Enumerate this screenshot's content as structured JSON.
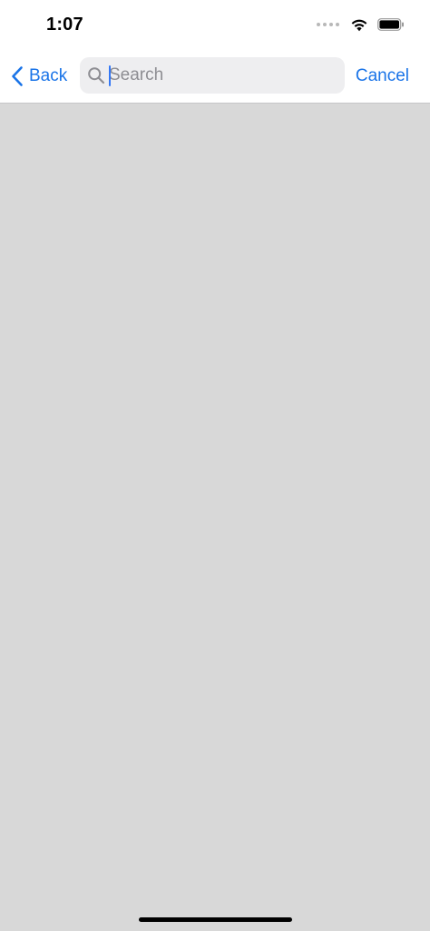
{
  "status_bar": {
    "time": "1:07",
    "icons": [
      "signal-dots-icon",
      "wifi-icon",
      "battery-icon"
    ]
  },
  "nav": {
    "back_label": "Back",
    "search_placeholder": "Search",
    "search_value": "",
    "cancel_label": "Cancel"
  },
  "colors": {
    "accent": "#1a74e8",
    "content_background": "#d8d8d8",
    "search_background": "#eeeef0",
    "placeholder": "#8e8e93"
  }
}
